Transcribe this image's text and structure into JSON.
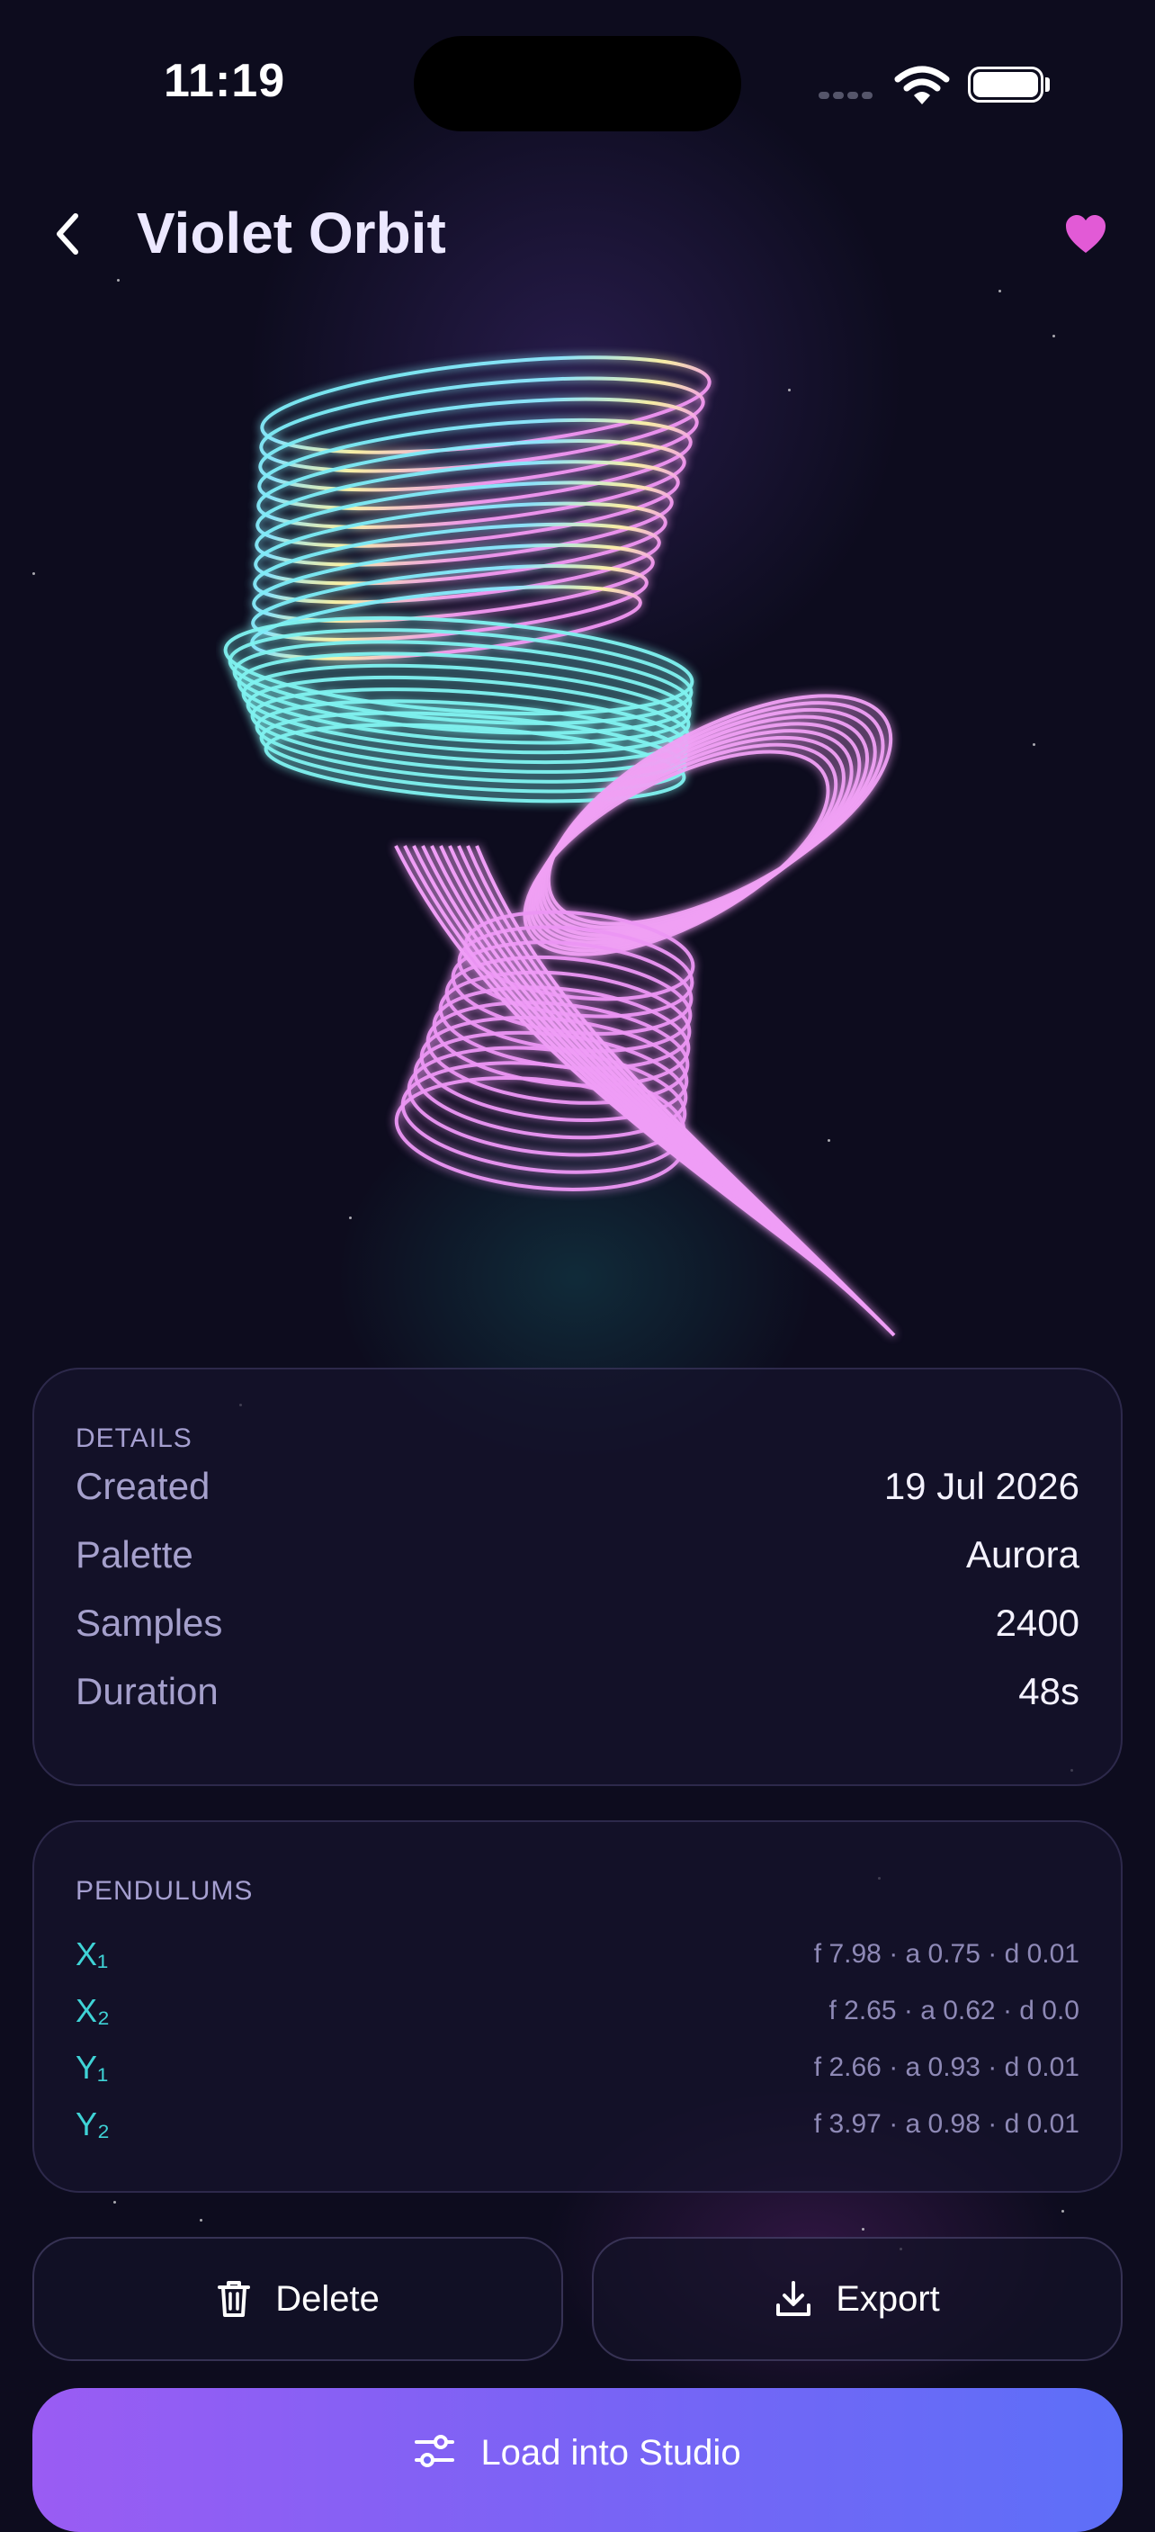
{
  "status_bar": {
    "time": "11:19"
  },
  "header": {
    "title": "Violet Orbit"
  },
  "details": {
    "label": "DETAILS",
    "rows": [
      {
        "key": "Created",
        "value": "19 Jul 2026"
      },
      {
        "key": "Palette",
        "value": "Aurora"
      },
      {
        "key": "Samples",
        "value": "2400"
      },
      {
        "key": "Duration",
        "value": "48s"
      }
    ]
  },
  "pendulums": {
    "label": "PENDULUMS",
    "rows": [
      {
        "name": "X₁",
        "params": "f 7.98 · a 0.75 · d 0.01"
      },
      {
        "name": "X₂",
        "params": "f 2.65 · a 0.62 · d 0.0"
      },
      {
        "name": "Y₁",
        "params": "f 2.66 · a 0.93 · d 0.01"
      },
      {
        "name": "Y₂",
        "params": "f 3.97 · a 0.98 · d 0.01"
      }
    ]
  },
  "actions": {
    "delete_label": "Delete",
    "export_label": "Export",
    "load_label": "Load into Studio"
  },
  "colors": {
    "accent": "#3fd3d6",
    "favorite": "#e25ad6",
    "gradient_start": "#9a5cf3",
    "gradient_end": "#5d6ff8"
  },
  "icons": {
    "back": "chevron-left-icon",
    "favorite": "heart-icon",
    "delete": "trash-icon",
    "export": "download-icon",
    "load": "sliders-icon"
  }
}
